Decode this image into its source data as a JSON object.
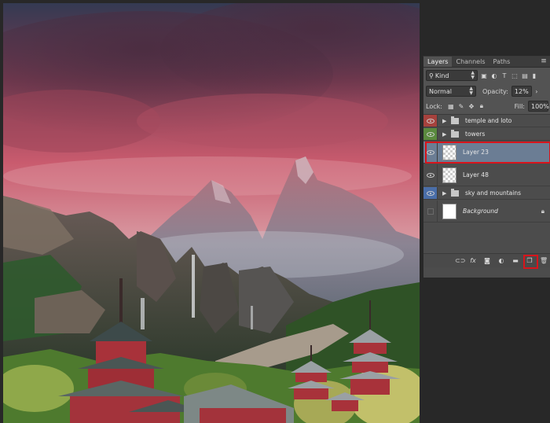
{
  "tabs": [
    {
      "label": "Layers",
      "active": true
    },
    {
      "label": "Channels",
      "active": false
    },
    {
      "label": "Paths",
      "active": false
    }
  ],
  "panel_menu_icon": "panel-menu-icon",
  "filter": {
    "kind_label": "Kind",
    "icons": [
      "image-filter-icon",
      "adjustment-filter-icon",
      "type-filter-icon",
      "shape-filter-icon",
      "smart-object-filter-icon"
    ]
  },
  "blend": {
    "mode": "Normal",
    "opacity_label": "Opacity:",
    "opacity_value": "12%"
  },
  "lock": {
    "label": "Lock:",
    "fill_label": "Fill:",
    "fill_value": "100%"
  },
  "layers": [
    {
      "name": "temple and loto",
      "type": "group",
      "tag_color": "#a6423d",
      "visible": true
    },
    {
      "name": "towers",
      "type": "group",
      "tag_color": "#5a8a3e",
      "visible": true
    },
    {
      "name": "Layer 23",
      "type": "layer",
      "selected": true,
      "visible": true
    },
    {
      "name": "Layer 48",
      "type": "layer",
      "visible": true
    },
    {
      "name": "sky and mountains",
      "type": "group",
      "tag_color": "#4a6ea8",
      "visible": true
    },
    {
      "name": "Background",
      "type": "background",
      "visible": false,
      "locked": true
    }
  ],
  "footer_icons": [
    "link-layers-icon",
    "fx-icon",
    "add-mask-icon",
    "adjustment-layer-icon",
    "new-group-icon",
    "new-layer-icon",
    "trash-icon"
  ],
  "colors": {
    "selected": "#6b7d94",
    "highlight": "#d8141b",
    "panel": "#535353"
  }
}
